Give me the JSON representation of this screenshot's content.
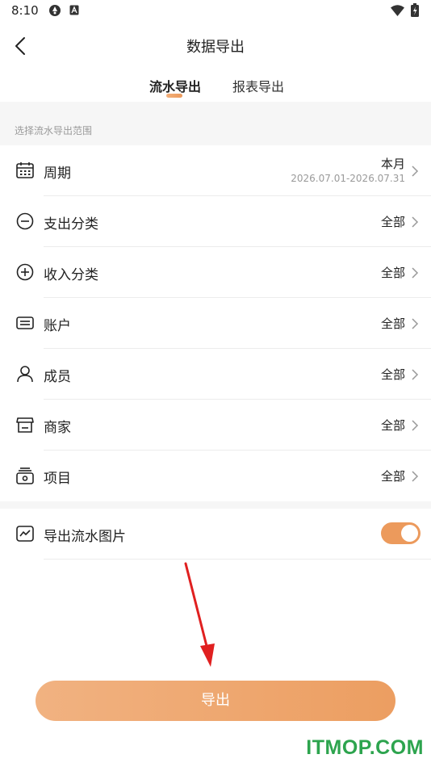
{
  "status_bar": {
    "time": "8:10"
  },
  "header": {
    "title": "数据导出"
  },
  "tabs": [
    {
      "label": "流水导出",
      "active": true
    },
    {
      "label": "报表导出",
      "active": false
    }
  ],
  "section": {
    "label": "选择流水导出范围"
  },
  "rows": [
    {
      "icon": "calendar-icon",
      "label": "周期",
      "value": "本月",
      "sub": "2026.07.01-2026.07.31"
    },
    {
      "icon": "minus-circle-icon",
      "label": "支出分类",
      "value": "全部"
    },
    {
      "icon": "plus-circle-icon",
      "label": "收入分类",
      "value": "全部"
    },
    {
      "icon": "card-icon",
      "label": "账户",
      "value": "全部"
    },
    {
      "icon": "person-icon",
      "label": "成员",
      "value": "全部"
    },
    {
      "icon": "store-icon",
      "label": "商家",
      "value": "全部"
    },
    {
      "icon": "project-icon",
      "label": "项目",
      "value": "全部"
    }
  ],
  "toggle_row": {
    "icon": "chart-image-icon",
    "label": "导出流水图片",
    "enabled": true
  },
  "export_button": {
    "label": "导出"
  },
  "watermark": "ITMOP.COM",
  "colors": {
    "accent": "#ec9a5c",
    "accent_light": "#f1b281",
    "annotation_arrow": "#e02020",
    "watermark": "#2da44e"
  }
}
